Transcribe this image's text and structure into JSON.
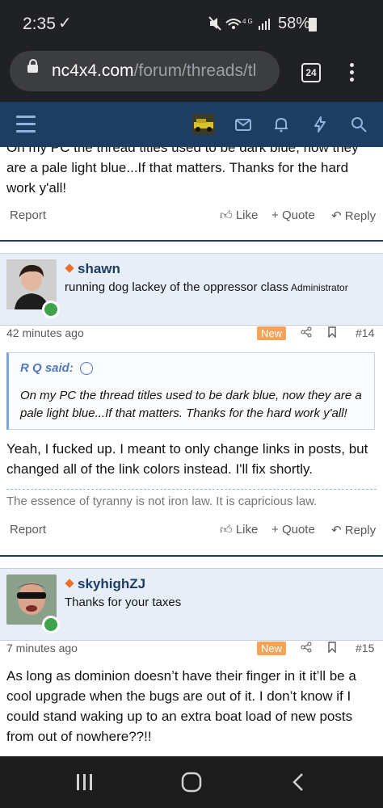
{
  "status": {
    "time": "2:35",
    "check_icon": "check-icon",
    "signal": "4G",
    "battery": "58%"
  },
  "browser": {
    "url_host": "nc4x4.com",
    "url_path": "/forum/threads/tl",
    "tab_count": "24"
  },
  "navbar": {
    "bg": "#1e3d63",
    "icons": [
      "menu-icon",
      "site-logo",
      "mail-icon",
      "bell-icon",
      "bolt-icon",
      "search-icon"
    ]
  },
  "post1": {
    "body_top": "On my PC the thread titles used to be dark blue, now they are a pale light blue...If that matters. Thanks for the hard work y'all!",
    "report": "Report",
    "like": "Like",
    "quote": "Quote",
    "reply": "Reply"
  },
  "post2": {
    "username": "shawn",
    "user_title": "running dog lackey of the oppressor class",
    "banner": "Administrator",
    "time": "42 minutes ago",
    "new_badge": "New",
    "post_number": "#14",
    "quote_author": "R Q said:",
    "quote_text": "On my PC the thread titles used to be dark blue, now they are a pale light blue...If that matters. Thanks for the hard work y'all!",
    "body": "Yeah, I fucked up. I meant to only change links in posts, but changed all of the link colors instead. I'll fix shortly.",
    "signature": "The essence of tyranny is not iron law. It is capricious law.",
    "report": "Report",
    "like": "Like",
    "quote": "Quote",
    "reply": "Reply"
  },
  "post3": {
    "username": "skyhighZJ",
    "user_title": "Thanks for your taxes",
    "time": "7 minutes ago",
    "new_badge": "New",
    "post_number": "#15",
    "body": "As long as dominion doesn’t have their finger in it it’ll be a cool upgrade when the bugs are out of it. I don’t know if I could stand waking up to an extra boat load of new posts from out of nowhere??!!"
  }
}
